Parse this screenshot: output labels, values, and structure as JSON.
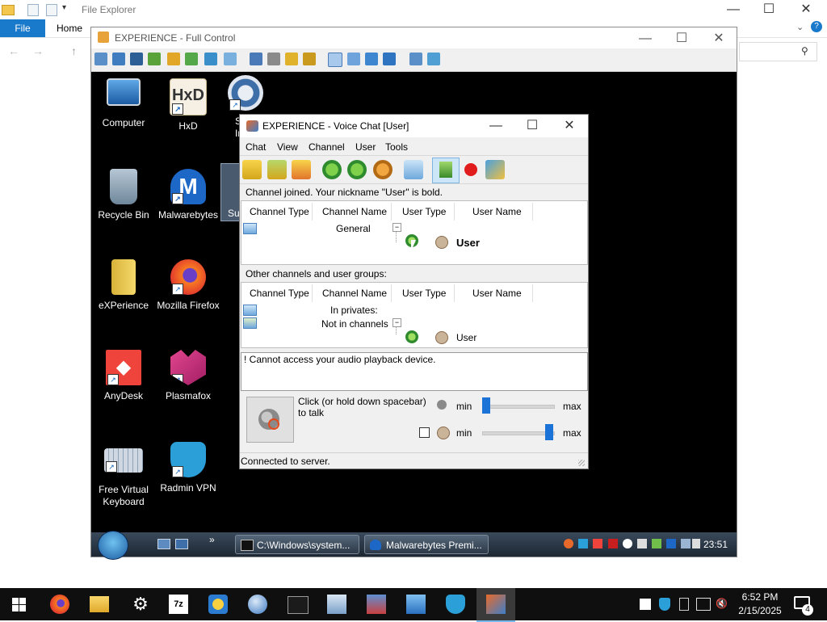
{
  "file_explorer": {
    "title": "File Explorer",
    "tabs": {
      "file": "File",
      "home": "Home"
    },
    "window_controls": {
      "minimize": "—",
      "maximize": "☐",
      "close": "✕"
    }
  },
  "remote_window": {
    "title": "EXPERIENCE - Full Control",
    "window_controls": {
      "minimize": "—",
      "maximize": "☐",
      "close": "✕"
    },
    "desktop_icons": [
      {
        "label": "Computer",
        "icon": "computer-icon"
      },
      {
        "label": "HxD",
        "icon": "hxd-icon"
      },
      {
        "label": "Recycle Bin",
        "icon": "recycle-bin-icon"
      },
      {
        "label": "Malwarebytes",
        "icon": "malwarebytes-icon"
      },
      {
        "label": "eXPerience",
        "icon": "folder-icon"
      },
      {
        "label": "Mozilla Firefox",
        "icon": "firefox-icon"
      },
      {
        "label": "AnyDesk",
        "icon": "anydesk-icon"
      },
      {
        "label": "Plasmafox",
        "icon": "plasmafox-icon"
      },
      {
        "label": "Free Virtual Keyboard",
        "icon": "keyboard-icon"
      },
      {
        "label": "Radmin VPN",
        "icon": "radmin-vpn-icon"
      }
    ],
    "partial_icon_labels": {
      "line1": "S",
      "line2": "In",
      "su": "Su"
    },
    "taskbar": {
      "buttons": [
        {
          "label": "C:\\Windows\\system..."
        },
        {
          "label": "Malwarebytes Premi..."
        }
      ],
      "clock": "23:51",
      "chevron": "»"
    }
  },
  "voice_chat": {
    "title": "EXPERIENCE - Voice Chat [User]",
    "menu": [
      "Chat",
      "View",
      "Channel",
      "User",
      "Tools"
    ],
    "channel_status": "Channel joined. Your nickname \"User\" is bold.",
    "columns": [
      "Channel Type",
      "Channel Name",
      "User Type",
      "User Name"
    ],
    "channel_row": {
      "name": "General",
      "user": "User",
      "expand": "−"
    },
    "other_label": "Other channels and user groups:",
    "other_rows": [
      {
        "name": "In privates:"
      },
      {
        "name": "Not in channels",
        "user": "User",
        "expand": "−"
      }
    ],
    "log_message": "! Cannot access your audio playback device.",
    "talk_label": "Click (or  hold down spacebar)\nto talk",
    "mic_slider": {
      "min_label": "min",
      "max_label": "max",
      "level": 0.0
    },
    "speaker_slider": {
      "min_label": "min",
      "max_label": "max",
      "level": 1.0
    },
    "status_bar": "Connected to server.",
    "window_controls": {
      "minimize": "—",
      "maximize": "☐",
      "close": "✕"
    }
  },
  "win_taskbar": {
    "time": "6:52 PM",
    "date": "2/15/2025",
    "notification_count": "4",
    "apps": [
      "firefox-icon",
      "file-explorer-icon",
      "settings-icon",
      "7zip-icon",
      "network-icon",
      "globe-icon",
      "cmd-icon",
      "computer-icon",
      "control-panel-icon",
      "remote-icon",
      "radmin-icon",
      "experience-icon"
    ]
  },
  "colors": {
    "accent": "#1979ca",
    "slider": "#1b73d8",
    "taskbar": "#0f0f0f"
  }
}
